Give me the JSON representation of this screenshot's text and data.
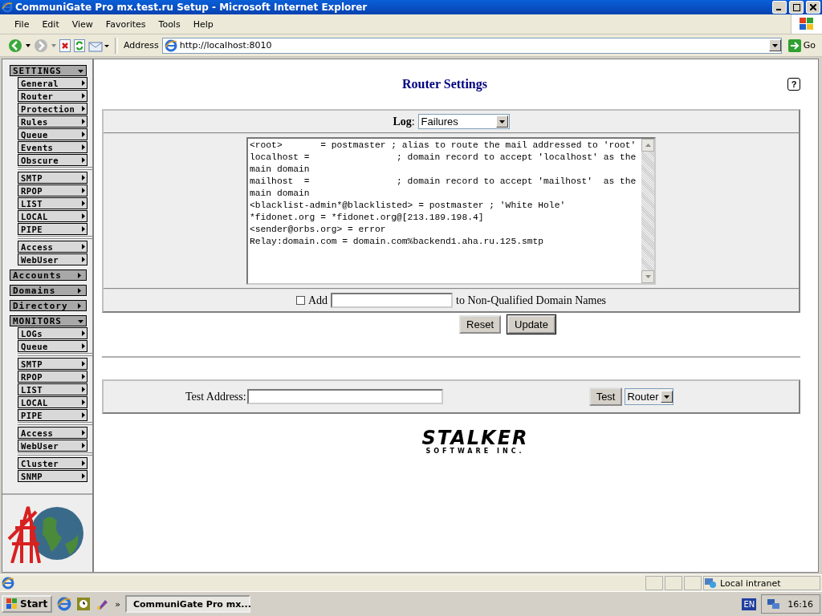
{
  "window": {
    "title": "CommuniGate Pro mx.test.ru Setup - Microsoft Internet Explorer"
  },
  "menu": [
    "File",
    "Edit",
    "View",
    "Favorites",
    "Tools",
    "Help"
  ],
  "toolbar": {
    "address_label": "Address",
    "address": "http://localhost:8010",
    "go": "Go"
  },
  "sidebar": {
    "sections": [
      {
        "label": "SETTINGS",
        "expanded": true,
        "groups": [
          [
            "General",
            "Router",
            "Protection",
            "Rules",
            "Queue",
            "Events",
            "Obscure"
          ],
          [
            "SMTP",
            "RPOP",
            "LIST",
            "LOCAL",
            "PIPE"
          ],
          [
            "Access",
            "WebUser"
          ]
        ]
      },
      {
        "label": "Accounts",
        "expanded": false
      },
      {
        "label": "Domains",
        "expanded": false
      },
      {
        "label": "Directory",
        "expanded": false
      },
      {
        "label": "MONITORS",
        "expanded": true,
        "groups": [
          [
            "LOGs",
            "Queue"
          ],
          [
            "SMTP",
            "RPOP",
            "LIST",
            "LOCAL",
            "PIPE"
          ],
          [
            "Access",
            "WebUser"
          ],
          [
            "Cluster",
            "SNMP"
          ]
        ]
      }
    ]
  },
  "page": {
    "title": "Router Settings",
    "help": "?",
    "log_label": "**Log**:",
    "log_value": "Failures",
    "rules": [
      "<root>       = postmaster ; alias to route the mail addressed to 'root'",
      "localhost =                ; domain record to accept 'localhost' as the main domain",
      "mailhost  =                ; domain record to accept 'mailhost'  as the main domain",
      "<blacklist-admin*@blacklisted> = postmaster ; 'White Hole'",
      "*fidonet.org = *fidonet.org@[213.189.198.4]",
      "<sender@orbs.org> = error",
      "Relay:domain.com = domain.com%backend1.aha.ru.125.smtp"
    ],
    "add_checked": false,
    "add_label": "Add",
    "add_suffix": "to Non-Qualified Domain Names",
    "buttons": [
      "Reset",
      "Update"
    ],
    "test_label": "Test Address:",
    "test_button": "Test",
    "test_mode": "Router"
  },
  "logo": {
    "name": "STALKER",
    "tagline": "SOFTWARE INC."
  },
  "status_bar": {
    "zone": "Local intranet"
  },
  "taskbar": {
    "start": "Start",
    "more": "»",
    "task": "CommuniGate Pro mx...",
    "language": "EN",
    "clock": "16:16"
  }
}
